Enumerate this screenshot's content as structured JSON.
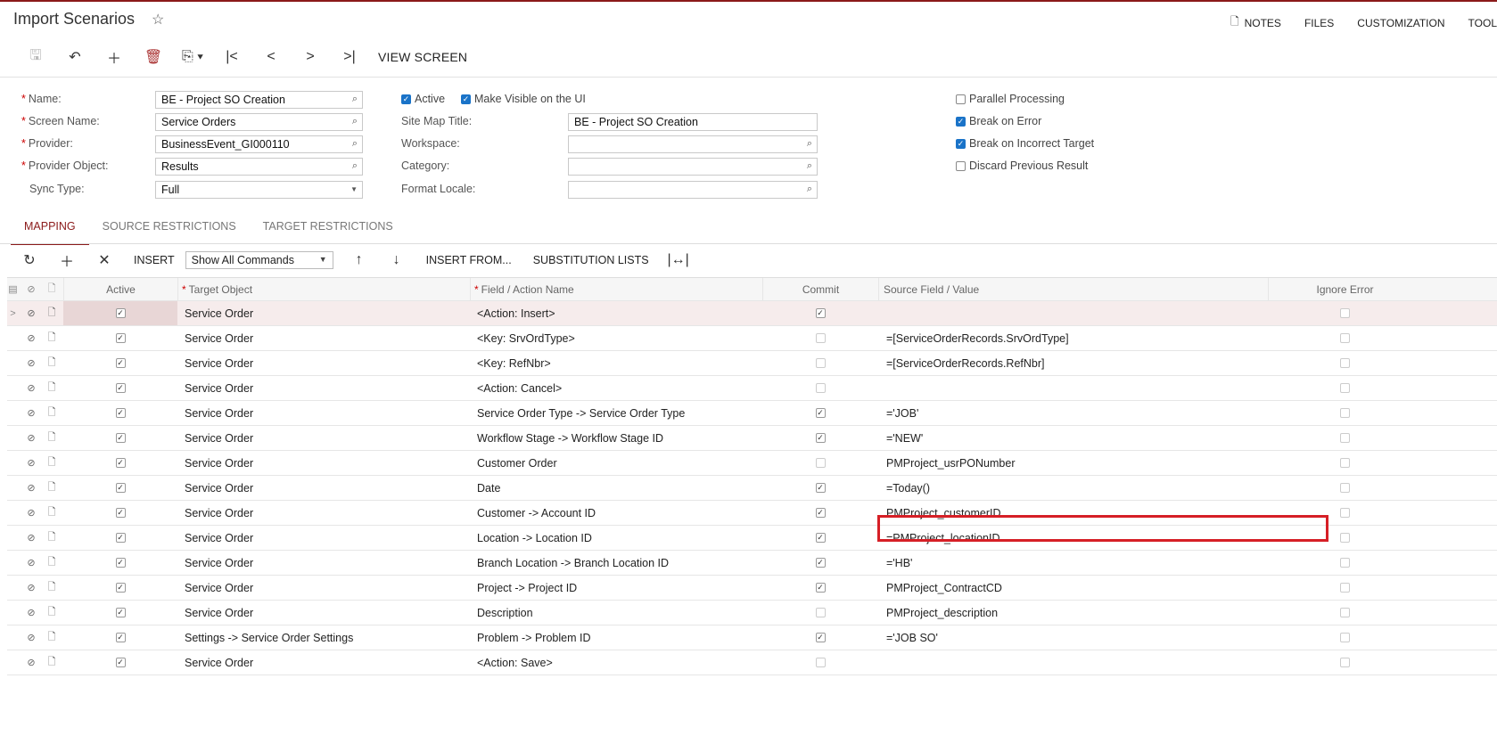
{
  "header": {
    "title": "Import Scenarios",
    "links": [
      "NOTES",
      "FILES",
      "CUSTOMIZATION",
      "TOOL"
    ]
  },
  "toolbar": {
    "view_screen": "VIEW SCREEN"
  },
  "form": {
    "name_label": "Name:",
    "name_value": "BE - Project SO Creation",
    "screen_label": "Screen Name:",
    "screen_value": "Service Orders",
    "provider_label": "Provider:",
    "provider_value": "BusinessEvent_GI000110",
    "provider_obj_label": "Provider Object:",
    "provider_obj_value": "Results",
    "sync_label": "Sync Type:",
    "sync_value": "Full",
    "active_label": "Active",
    "visible_label": "Make Visible on the UI",
    "sitemap_label": "Site Map Title:",
    "sitemap_value": "BE - Project SO Creation",
    "workspace_label": "Workspace:",
    "category_label": "Category:",
    "locale_label": "Format Locale:",
    "parallel_label": "Parallel Processing",
    "break_error_label": "Break on Error",
    "break_target_label": "Break on Incorrect Target",
    "discard_label": "Discard Previous Result"
  },
  "tabs": [
    "MAPPING",
    "SOURCE RESTRICTIONS",
    "TARGET RESTRICTIONS"
  ],
  "grid_toolbar": {
    "insert": "INSERT",
    "filter": "Show All Commands",
    "insert_from": "INSERT FROM...",
    "subst": "SUBSTITUTION LISTS"
  },
  "columns": {
    "active": "Active",
    "target": "Target Object",
    "field": "Field / Action Name",
    "commit": "Commit",
    "source": "Source Field / Value",
    "ignore": "Ignore Error"
  },
  "rows": [
    {
      "target": "Service Order",
      "field": "<Action: Insert>",
      "commit": true,
      "source": ""
    },
    {
      "target": "Service Order",
      "field": "<Key: SrvOrdType>",
      "commit": false,
      "source": "=[ServiceOrderRecords.SrvOrdType]"
    },
    {
      "target": "Service Order",
      "field": "<Key: RefNbr>",
      "commit": false,
      "source": "=[ServiceOrderRecords.RefNbr]"
    },
    {
      "target": "Service Order",
      "field": "<Action: Cancel>",
      "commit": false,
      "source": ""
    },
    {
      "target": "Service Order",
      "field": "Service Order Type -> Service Order Type",
      "commit": true,
      "source": "='JOB'"
    },
    {
      "target": "Service Order",
      "field": "Workflow Stage -> Workflow Stage ID",
      "commit": true,
      "source": "='NEW'"
    },
    {
      "target": "Service Order",
      "field": "Customer Order",
      "commit": false,
      "source": "PMProject_usrPONumber"
    },
    {
      "target": "Service Order",
      "field": "Date",
      "commit": true,
      "source": "=Today()"
    },
    {
      "target": "Service Order",
      "field": "Customer -> Account ID",
      "commit": true,
      "source": "PMProject_customerID"
    },
    {
      "target": "Service Order",
      "field": "Location -> Location ID",
      "commit": true,
      "source": "=PMProject_locationID"
    },
    {
      "target": "Service Order",
      "field": "Branch Location -> Branch Location ID",
      "commit": true,
      "source": "='HB'"
    },
    {
      "target": "Service Order",
      "field": "Project -> Project ID",
      "commit": true,
      "source": "PMProject_ContractCD"
    },
    {
      "target": "Service Order",
      "field": "Description",
      "commit": false,
      "source": "PMProject_description"
    },
    {
      "target": "Settings -> Service Order Settings",
      "field": "Problem -> Problem ID",
      "commit": true,
      "source": "='JOB SO'"
    },
    {
      "target": "Service Order",
      "field": "<Action: Save>",
      "commit": false,
      "source": ""
    }
  ]
}
